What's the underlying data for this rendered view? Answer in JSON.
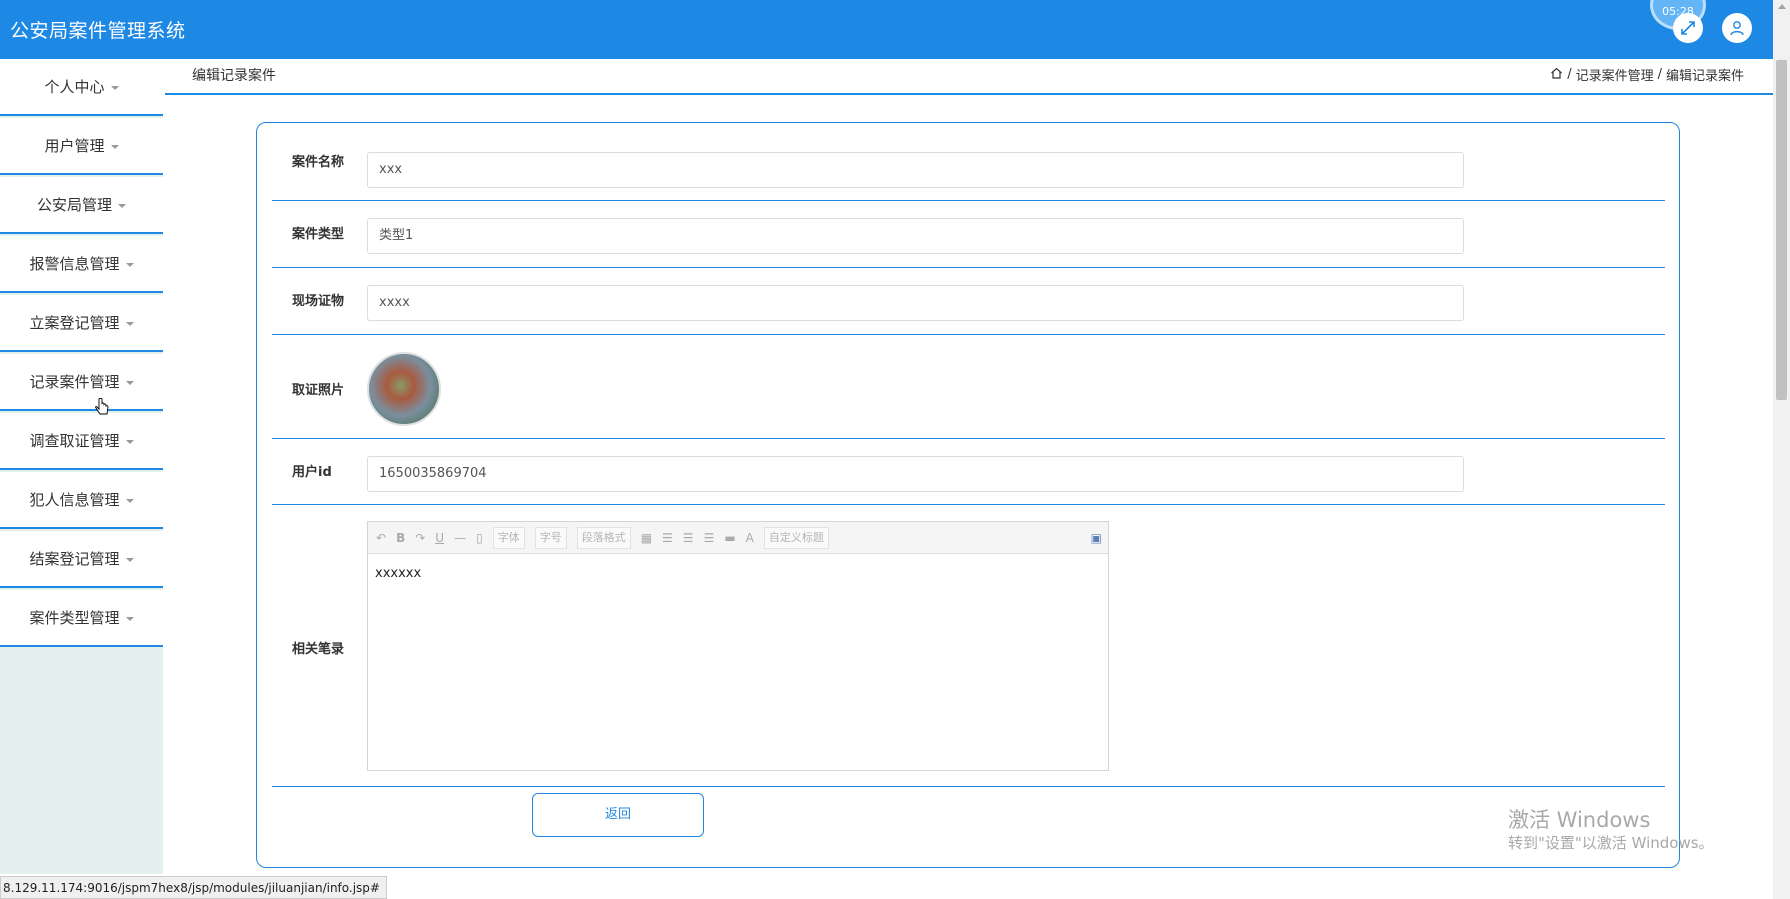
{
  "app_title": "公安局案件管理系统",
  "top_timer": "05:28",
  "sidebar": {
    "items": [
      {
        "label": "个人中心"
      },
      {
        "label": "用户管理"
      },
      {
        "label": "公安局管理"
      },
      {
        "label": "报警信息管理"
      },
      {
        "label": "立案登记管理"
      },
      {
        "label": "记录案件管理"
      },
      {
        "label": "调查取证管理"
      },
      {
        "label": "犯人信息管理"
      },
      {
        "label": "结案登记管理"
      },
      {
        "label": "案件类型管理"
      }
    ]
  },
  "page": {
    "title": "编辑记录案件",
    "breadcrumb": [
      "记录案件管理",
      "编辑记录案件"
    ],
    "breadcrumb_sep": "/"
  },
  "form": {
    "case_name": {
      "label": "案件名称",
      "value": "xxx"
    },
    "case_type": {
      "label": "案件类型",
      "value": "类型1"
    },
    "evidence": {
      "label": "现场证物",
      "value": "xxxx"
    },
    "photo": {
      "label": "取证照片"
    },
    "user_id": {
      "label": "用户id",
      "value": "1650035869704"
    },
    "notes": {
      "label": "相关笔录",
      "content": "xxxxxx",
      "toolbar": {
        "bold": "B",
        "underline": "U",
        "hr": "—",
        "font_family": "字体",
        "font_size": "字号",
        "paragraph": "段落格式",
        "font_color": "A",
        "custom_title": "自定义标题"
      }
    }
  },
  "back_button": "返回",
  "watermark": {
    "line1": "激活 Windows",
    "line2": "转到\"设置\"以激活 Windows。"
  },
  "status_url": "8.129.11.174:9016/jspm7hex8/jsp/modules/jiluanjian/info.jsp#",
  "colors": {
    "primary": "#1e88e5",
    "sidebar_bg": "#e3f0ed"
  }
}
